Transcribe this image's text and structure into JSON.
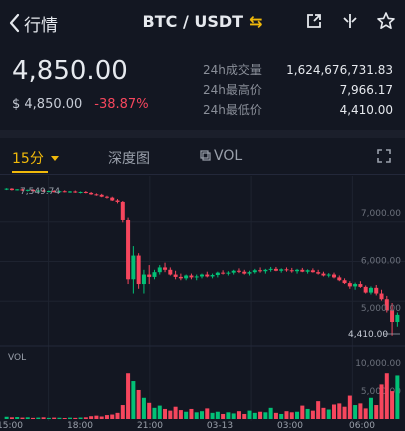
{
  "header": {
    "back_label": "行情",
    "pair": "BTC / USDT",
    "swap_glyph": "⇆",
    "icons": [
      "share-icon",
      "indicator-icon",
      "star-icon"
    ]
  },
  "price": {
    "last": "4,850.00",
    "fiat": "$ 4,850.00",
    "change": "-38.87%"
  },
  "stats": [
    {
      "label": "24h成交量",
      "value": "1,624,676,731.83"
    },
    {
      "label": "24h最高价",
      "value": "7,966.17"
    },
    {
      "label": "24h最低价",
      "value": "4,410.00"
    }
  ],
  "tabs": {
    "interval": "15分",
    "depth": "深度图",
    "vol": "VOL"
  },
  "chart_data": {
    "type": "candlestick",
    "high_marker": "7,549.74",
    "low_marker": "4,410.00",
    "price_ticks": [
      "7,000.00",
      "6,000.00",
      "5,000.00"
    ],
    "vol_label": "VOL",
    "vol_ticks": [
      "10,000.00",
      "5,000.00"
    ],
    "x_ticks": [
      "15:00",
      "18:00",
      "21:00",
      "03-13",
      "03:00",
      "06:00"
    ],
    "colors": {
      "up": "#02c076",
      "down": "#f6465d"
    },
    "candles": [
      [
        7500,
        7520,
        7480,
        7510
      ],
      [
        7510,
        7520,
        7470,
        7480
      ],
      [
        7480,
        7500,
        7470,
        7495
      ],
      [
        7495,
        7510,
        7460,
        7470
      ],
      [
        7470,
        7490,
        7450,
        7485
      ],
      [
        7485,
        7500,
        7450,
        7455
      ],
      [
        7455,
        7480,
        7440,
        7470
      ],
      [
        7470,
        7490,
        7440,
        7445
      ],
      [
        7445,
        7470,
        7430,
        7460
      ],
      [
        7460,
        7480,
        7430,
        7435
      ],
      [
        7435,
        7470,
        7420,
        7455
      ],
      [
        7455,
        7475,
        7430,
        7440
      ],
      [
        7440,
        7460,
        7420,
        7450
      ],
      [
        7450,
        7470,
        7420,
        7430
      ],
      [
        7430,
        7450,
        7410,
        7440
      ],
      [
        7440,
        7460,
        7410,
        7420
      ],
      [
        7420,
        7440,
        7380,
        7390
      ],
      [
        7390,
        7410,
        7360,
        7380
      ],
      [
        7380,
        7400,
        7330,
        7340
      ],
      [
        7340,
        7360,
        7300,
        7320
      ],
      [
        7320,
        7340,
        7250,
        7260
      ],
      [
        7260,
        7290,
        7200,
        7230
      ],
      [
        7230,
        7250,
        6800,
        6850
      ],
      [
        6850,
        6900,
        5500,
        5600
      ],
      [
        5600,
        6300,
        5300,
        6100
      ],
      [
        6100,
        6150,
        5400,
        5500
      ],
      [
        5500,
        5800,
        5300,
        5700
      ],
      [
        5700,
        5900,
        5500,
        5650
      ],
      [
        5650,
        5800,
        5600,
        5750
      ],
      [
        5750,
        5900,
        5700,
        5850
      ],
      [
        5850,
        5950,
        5750,
        5800
      ],
      [
        5800,
        5850,
        5680,
        5700
      ],
      [
        5700,
        5780,
        5600,
        5650
      ],
      [
        5650,
        5720,
        5580,
        5620
      ],
      [
        5620,
        5700,
        5580,
        5680
      ],
      [
        5680,
        5720,
        5600,
        5640
      ],
      [
        5640,
        5700,
        5580,
        5660
      ],
      [
        5660,
        5720,
        5620,
        5700
      ],
      [
        5700,
        5760,
        5640,
        5660
      ],
      [
        5660,
        5720,
        5620,
        5690
      ],
      [
        5690,
        5760,
        5640,
        5740
      ],
      [
        5740,
        5790,
        5700,
        5720
      ],
      [
        5720,
        5770,
        5680,
        5740
      ],
      [
        5740,
        5800,
        5700,
        5780
      ],
      [
        5780,
        5830,
        5730,
        5760
      ],
      [
        5760,
        5800,
        5700,
        5720
      ],
      [
        5720,
        5780,
        5680,
        5750
      ],
      [
        5750,
        5820,
        5720,
        5790
      ],
      [
        5790,
        5850,
        5740,
        5770
      ],
      [
        5770,
        5820,
        5720,
        5800
      ],
      [
        5800,
        5860,
        5760,
        5820
      ],
      [
        5820,
        5860,
        5770,
        5780
      ],
      [
        5780,
        5830,
        5740,
        5810
      ],
      [
        5810,
        5850,
        5760,
        5790
      ],
      [
        5790,
        5840,
        5740,
        5770
      ],
      [
        5770,
        5820,
        5720,
        5800
      ],
      [
        5800,
        5840,
        5750,
        5760
      ],
      [
        5760,
        5810,
        5720,
        5790
      ],
      [
        5790,
        5830,
        5740,
        5750
      ],
      [
        5750,
        5800,
        5700,
        5720
      ],
      [
        5720,
        5760,
        5660,
        5680
      ],
      [
        5680,
        5730,
        5640,
        5700
      ],
      [
        5700,
        5740,
        5620,
        5640
      ],
      [
        5640,
        5680,
        5560,
        5580
      ],
      [
        5580,
        5620,
        5500,
        5520
      ],
      [
        5520,
        5560,
        5400,
        5450
      ],
      [
        5450,
        5530,
        5380,
        5500
      ],
      [
        5500,
        5560,
        5420,
        5440
      ],
      [
        5440,
        5470,
        5300,
        5320
      ],
      [
        5320,
        5450,
        5280,
        5420
      ],
      [
        5420,
        5480,
        5260,
        5300
      ],
      [
        5300,
        5380,
        5150,
        5180
      ],
      [
        5180,
        5250,
        4900,
        4950
      ],
      [
        4950,
        5100,
        4410,
        4700
      ],
      [
        4700,
        4900,
        4600,
        4850
      ]
    ],
    "volumes": [
      400,
      300,
      350,
      250,
      300,
      200,
      250,
      300,
      200,
      250,
      220,
      180,
      240,
      200,
      260,
      300,
      500,
      600,
      450,
      700,
      800,
      1100,
      2500,
      8200,
      6800,
      5200,
      3800,
      2900,
      2000,
      2400,
      1800,
      1500,
      2200,
      1600,
      1300,
      1800,
      1200,
      1400,
      1900,
      1100,
      1300,
      900,
      1200,
      1000,
      1400,
      900,
      1500,
      1100,
      1300,
      1200,
      2000,
      1100,
      900,
      1400,
      1200,
      1300,
      2400,
      1800,
      1500,
      3200,
      2000,
      1700,
      2600,
      2800,
      2200,
      4200,
      2500,
      2800,
      1900,
      3800,
      2500,
      6200,
      8200,
      5000,
      7800
    ]
  }
}
